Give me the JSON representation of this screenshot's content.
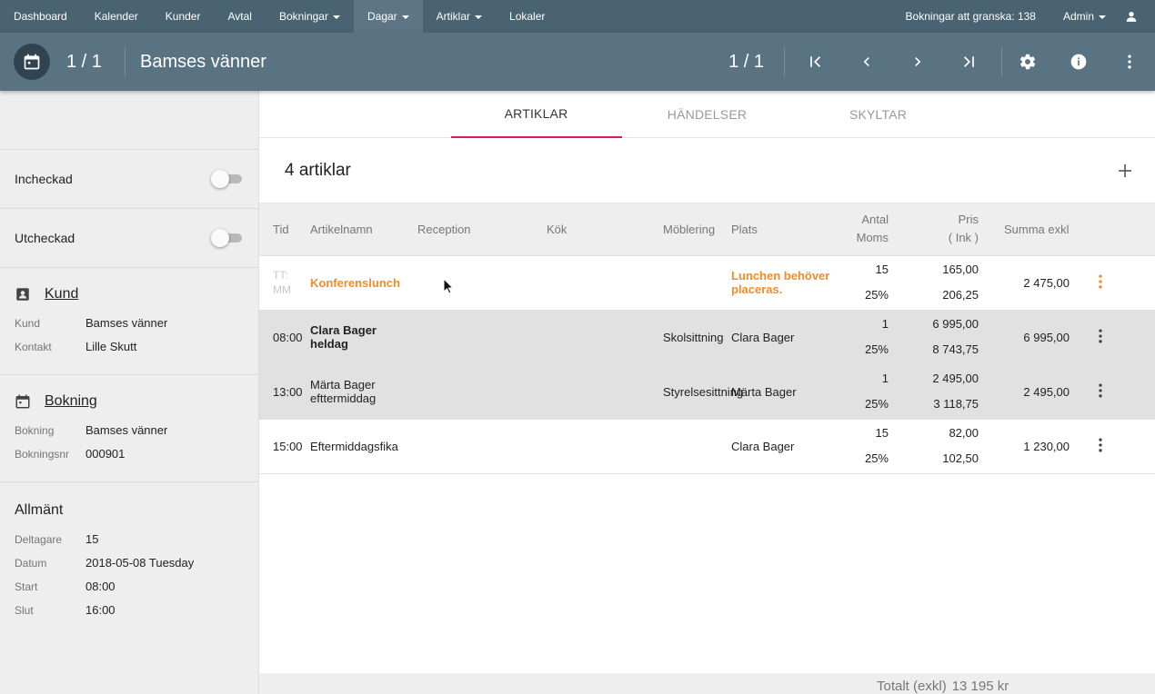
{
  "nav": {
    "items": [
      {
        "label": "Dashboard",
        "caret": false,
        "active": false
      },
      {
        "label": "Kalender",
        "caret": false,
        "active": false
      },
      {
        "label": "Kunder",
        "caret": false,
        "active": false
      },
      {
        "label": "Avtal",
        "caret": false,
        "active": false
      },
      {
        "label": "Bokningar",
        "caret": true,
        "active": false
      },
      {
        "label": "Dagar",
        "caret": true,
        "active": true
      },
      {
        "label": "Artiklar",
        "caret": true,
        "active": false
      },
      {
        "label": "Lokaler",
        "caret": false,
        "active": false
      }
    ],
    "review": "Bokningar att granska: 138",
    "admin": "Admin"
  },
  "toolbar": {
    "counter": "1 / 1",
    "title": "Bamses vänner",
    "right_counter": "1 / 1"
  },
  "sidebar": {
    "toggles": [
      {
        "label": "Incheckad",
        "on": false
      },
      {
        "label": "Utcheckad",
        "on": false
      }
    ],
    "kund": {
      "heading": "Kund",
      "rows": [
        {
          "k": "Kund",
          "v": "Bamses vänner"
        },
        {
          "k": "Kontakt",
          "v": "Lille Skutt"
        }
      ]
    },
    "bokning": {
      "heading": "Bokning",
      "rows": [
        {
          "k": "Bokning",
          "v": "Bamses vänner"
        },
        {
          "k": "Bokningsnr",
          "v": "000901"
        }
      ]
    },
    "allmant": {
      "heading": "Allmänt",
      "rows": [
        {
          "k": "Deltagare",
          "v": "15"
        },
        {
          "k": "Datum",
          "v": "2018-05-08 Tuesday"
        },
        {
          "k": "Start",
          "v": "08:00"
        },
        {
          "k": "Slut",
          "v": "16:00"
        }
      ]
    }
  },
  "tabs": [
    {
      "label": "ARTIKLAR",
      "active": true
    },
    {
      "label": "HÄNDELSER",
      "active": false
    },
    {
      "label": "SKYLTAR",
      "active": false
    }
  ],
  "list": {
    "title": "4 artiklar",
    "columns": {
      "tid": "Tid",
      "artikelnamn": "Artikelnamn",
      "reception": "Reception",
      "kok": "Kök",
      "moblering": "Möblering",
      "plats": "Plats",
      "antal": "Antal",
      "moms": "Moms",
      "pris": "Pris",
      "pris_sub": "( Ink )",
      "summa": "Summa exkl"
    },
    "rows": [
      {
        "tid": "TT:\nMM",
        "tid_faint": true,
        "name": "Konferenslunch",
        "style": "orange",
        "reception": "",
        "kok": "",
        "moblering": "",
        "plats": "Lunchen behöver placeras.",
        "plats_orange": true,
        "antal": "15",
        "moms": "25%",
        "pris": "165,00",
        "pris_ink": "206,25",
        "summa": "2 475,00",
        "grey": false,
        "dots_orange": true
      },
      {
        "tid": "08:00",
        "tid_faint": false,
        "name": "Clara Bager heldag",
        "style": "bold",
        "reception": "",
        "kok": "",
        "moblering": "Skolsittning",
        "plats": "Clara Bager",
        "plats_orange": false,
        "antal": "1",
        "moms": "25%",
        "pris": "6 995,00",
        "pris_ink": "8 743,75",
        "summa": "6 995,00",
        "grey": true,
        "dots_orange": false
      },
      {
        "tid": "13:00",
        "tid_faint": false,
        "name": "Märta Bager efttermiddag",
        "style": "normal",
        "reception": "",
        "kok": "",
        "moblering": "Styrelsesittning",
        "plats": "Märta Bager",
        "plats_orange": false,
        "antal": "1",
        "moms": "25%",
        "pris": "2 495,00",
        "pris_ink": "3 118,75",
        "summa": "2 495,00",
        "grey": true,
        "dots_orange": false
      },
      {
        "tid": "15:00",
        "tid_faint": false,
        "name": "Eftermiddagsfika",
        "style": "normal",
        "reception": "",
        "kok": "",
        "moblering": "",
        "plats": "Clara Bager",
        "plats_orange": false,
        "antal": "15",
        "moms": "25%",
        "pris": "82,00",
        "pris_ink": "102,50",
        "summa": "1 230,00",
        "grey": false,
        "dots_orange": false
      }
    ],
    "total_label": "Totalt (exkl)",
    "total_value": "13 195 kr"
  },
  "colors": {
    "nav_bg": "#4a6373",
    "toolbar_bg": "#597383",
    "accent": "#e0185e",
    "warning": "#ef8d2a"
  },
  "icons": [
    "calendar-icon",
    "first-page-icon",
    "prev-icon",
    "next-icon",
    "last-page-icon",
    "settings-icon",
    "info-icon",
    "more-vert-icon",
    "user-icon",
    "contact-card-icon",
    "event-icon",
    "add-icon"
  ]
}
